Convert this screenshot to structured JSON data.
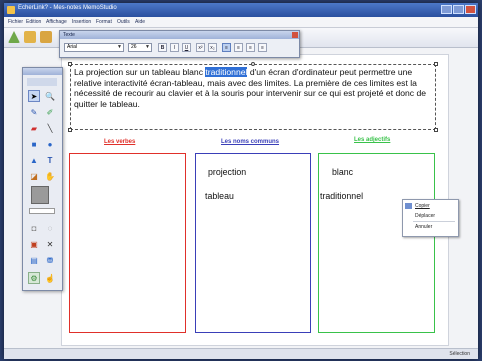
{
  "window": {
    "title": "EcherLink? - Mes-notes MemoStudio"
  },
  "menu": [
    "Fichier",
    "Edition",
    "Affichage",
    "Insertion",
    "Format",
    "Outils",
    "Aide"
  ],
  "text_palette": {
    "title": "Texte",
    "font": "Arial",
    "size": "26",
    "buttons": [
      "B",
      "I",
      "U",
      "x²",
      "x₂",
      "≡",
      "≡",
      "≡",
      "≡"
    ]
  },
  "paragraph": {
    "before": "La projection sur un tableau blanc ",
    "highlight": "traditionnel",
    "after": " d'un écran d'ordinateur peut permettre une relative interactivité écran-tableau, mais avec des limites. La première de ces limites est la nécessité de recourir au clavier et à la souris pour intervenir sur ce qui est projeté et donc de quitter le tableau."
  },
  "categories": [
    {
      "label": "Les verbes",
      "color": "#e0302a",
      "words": []
    },
    {
      "label": "Les noms communs",
      "color": "#3a3fb8",
      "words": [
        "projection",
        "tableau"
      ]
    },
    {
      "label": "Les adjectifs",
      "color": "#39c24a",
      "words": [
        "blanc",
        "traditionnel"
      ]
    }
  ],
  "context_menu": [
    "Copier",
    "Déplacer",
    "Annuler"
  ],
  "status": {
    "text": "Sélection"
  },
  "icons": [
    "select-icon",
    "zoom-icon",
    "pen-icon",
    "highlighter-icon",
    "eraser-icon",
    "line-icon",
    "rectangle-icon",
    "ellipse-icon",
    "text-icon",
    "fill-icon",
    "hand-icon",
    "image-icon",
    "color-icon",
    "delete-icon",
    "screen-icon",
    "record-icon"
  ]
}
